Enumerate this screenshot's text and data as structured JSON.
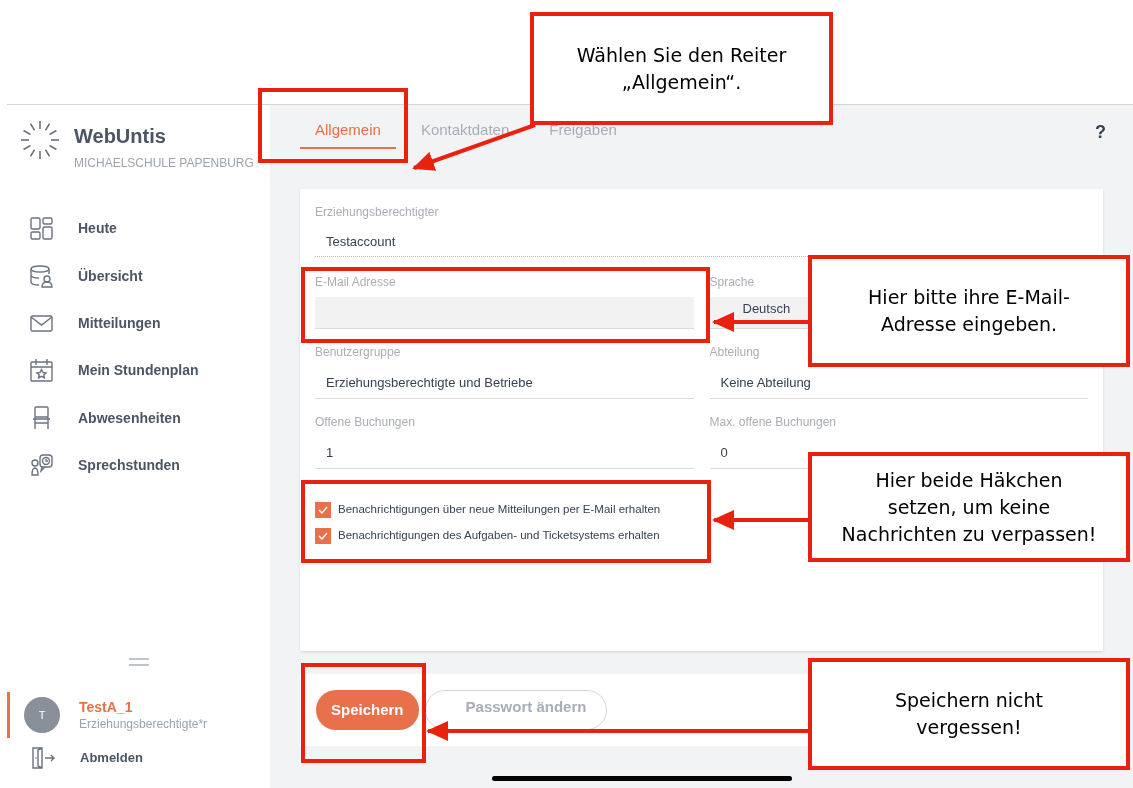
{
  "sidebar": {
    "title": "WebUntis",
    "school": "MICHAELSCHULE PAPENBURG",
    "nav": [
      {
        "label": "Heute"
      },
      {
        "label": "Übersicht"
      },
      {
        "label": "Mitteilungen"
      },
      {
        "label": "Mein Stundenplan"
      },
      {
        "label": "Abwesenheiten"
      },
      {
        "label": "Sprechstunden"
      }
    ],
    "user": {
      "initial": "T",
      "name": "TestA_1",
      "role": "Erziehungsberechtigte*r"
    },
    "logout": "Abmelden"
  },
  "tabs": [
    {
      "label": "Allgemein",
      "selected": true
    },
    {
      "label": "Kontaktdaten",
      "selected": false
    },
    {
      "label": "Freigaben",
      "selected": false
    }
  ],
  "help": "?",
  "fields": [
    {
      "kind": "readonly",
      "label": "Erziehungsberechtigter",
      "value": "Testaccount"
    },
    {
      "kind": "input",
      "label": "E-Mail Adresse"
    },
    {
      "kind": "select",
      "label": "Sprache",
      "value": "Deutsch"
    },
    {
      "kind": "text",
      "label": "Benutzergruppe",
      "value": "Erziehungsberechtigte und Betriebe"
    },
    {
      "kind": "text",
      "label": "Abteilung",
      "value": "Keine Abteilung"
    },
    {
      "kind": "text",
      "label": "Offene Buchungen",
      "value": "1"
    },
    {
      "kind": "text",
      "label": "Max. offene Buchungen",
      "value": "0"
    }
  ],
  "checkboxes": [
    {
      "label": "Benachrichtigungen über neue Mitteilungen per E-Mail erhalten",
      "checked": true
    },
    {
      "label": "Benachrichtigungen des Aufgaben- und Ticketsystems erhalten",
      "checked": true
    }
  ],
  "buttons": [
    {
      "kind": "primary",
      "label": "Speichern"
    },
    {
      "kind": "secondary",
      "label": "Passwort ändern"
    }
  ],
  "annotations": [
    "Wählen Sie den Reiter „Allgemein“.",
    "Hier bitte ihre E-Mail-Adresse eingeben.",
    "Hier beide Häkchen setzen, um keine Nachrichten zu verpassen!",
    "Speichern nicht vergessen!"
  ]
}
